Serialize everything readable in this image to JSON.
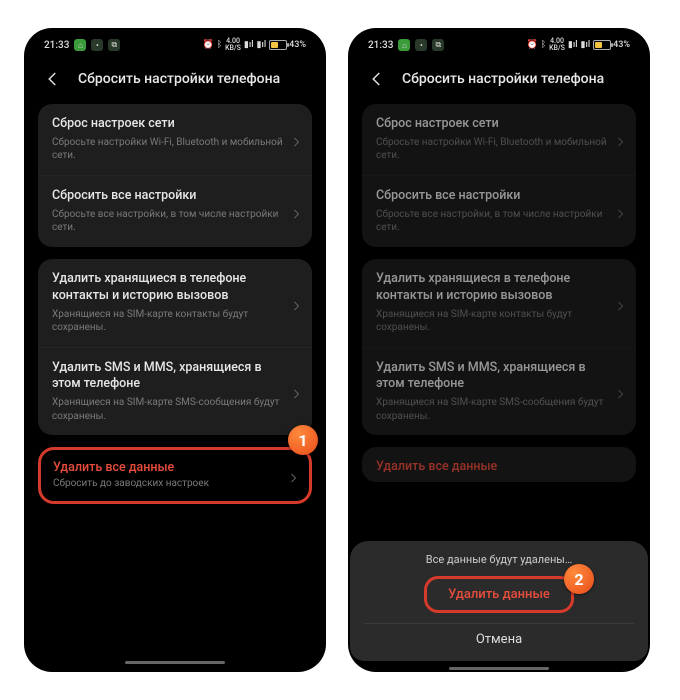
{
  "status": {
    "time": "21:33",
    "network_speed_top": "4.00",
    "network_speed_unit": "KB/S",
    "battery_pct": "43%"
  },
  "header": {
    "title": "Сбросить настройки телефона"
  },
  "group1": {
    "item1": {
      "title": "Сброс настроек сети",
      "sub": "Сбросьте настройки Wi-Fi, Bluetooth и мобильной сети."
    },
    "item2": {
      "title": "Сбросить все настройки",
      "sub": "Сбросьте все настройки, в том числе настройки сети."
    }
  },
  "group2": {
    "item1": {
      "title": "Удалить хранящиеся в телефоне контакты и историю вызовов",
      "sub": "Хранящиеся на SIM-карте контакты будут сохранены."
    },
    "item2": {
      "title": "Удалить SMS и MMS, хранящиеся в этом телефоне",
      "sub": "Хранящиеся на SIM-карте SMS-сообщения будут сохранены."
    }
  },
  "group3": {
    "item1": {
      "title": "Удалить все данные",
      "sub": "Сбросить до заводских настроек"
    }
  },
  "dialog": {
    "message": "Все данные будут удалены…",
    "confirm": "Удалить данные",
    "cancel": "Отмена"
  },
  "callouts": {
    "one": "1",
    "two": "2"
  }
}
